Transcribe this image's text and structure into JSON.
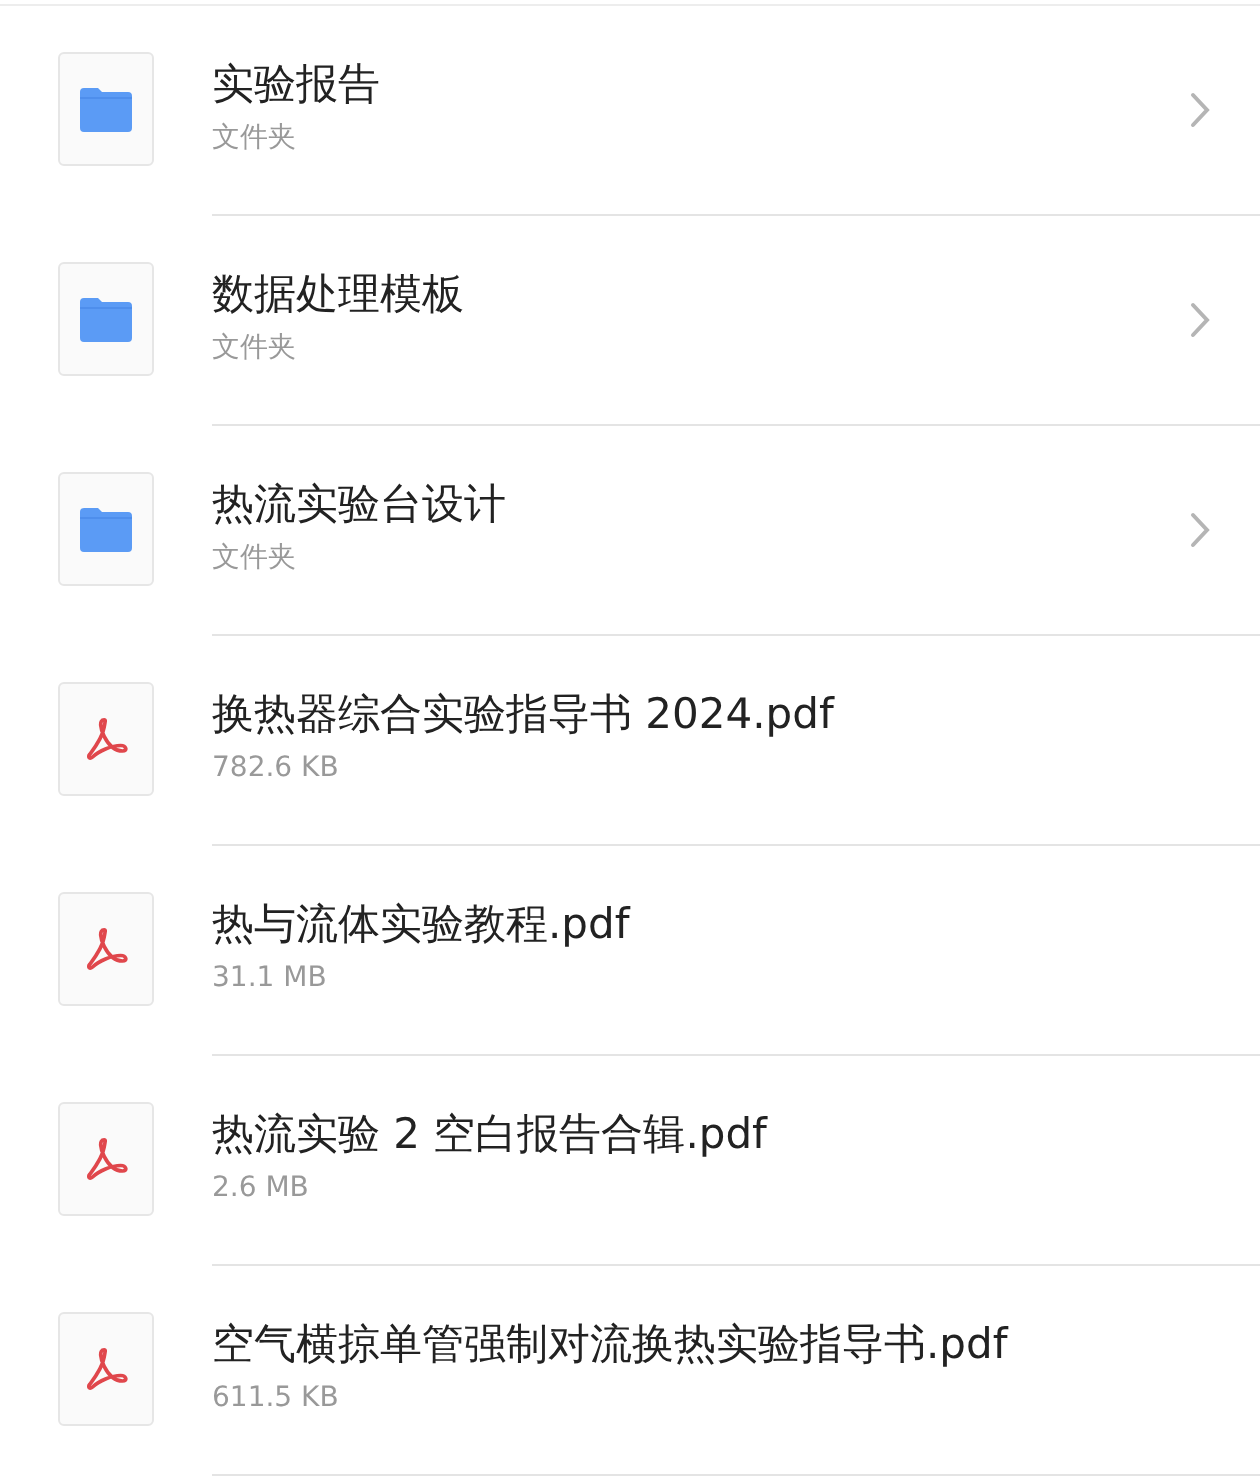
{
  "files": [
    {
      "kind": "folder",
      "name": "实验报告",
      "detail": "文件夹"
    },
    {
      "kind": "folder",
      "name": "数据处理模板",
      "detail": "文件夹"
    },
    {
      "kind": "folder",
      "name": "热流实验台设计",
      "detail": "文件夹"
    },
    {
      "kind": "pdf",
      "name": "换热器综合实验指导书 2024.pdf",
      "detail": "782.6 KB"
    },
    {
      "kind": "pdf",
      "name": "热与流体实验教程.pdf",
      "detail": "31.1 MB"
    },
    {
      "kind": "pdf",
      "name": "热流实验 2 空白报告合辑.pdf",
      "detail": "2.6 MB"
    },
    {
      "kind": "pdf",
      "name": "空气横掠单管强制对流换热实验指导书.pdf",
      "detail": "611.5 KB"
    }
  ]
}
